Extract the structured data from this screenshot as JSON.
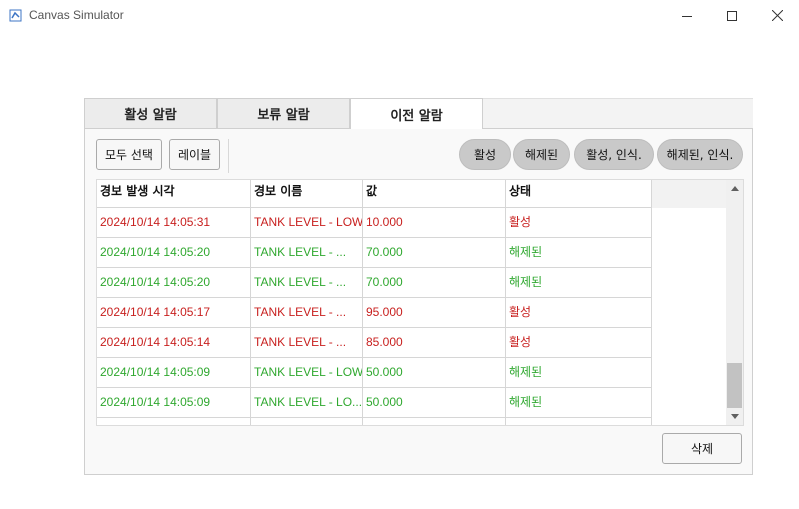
{
  "window": {
    "title": "Canvas Simulator"
  },
  "tabs": [
    {
      "label": "활성 알람",
      "active": false
    },
    {
      "label": "보류 알람",
      "active": false
    },
    {
      "label": "이전 알람",
      "active": true
    }
  ],
  "toolbar": {
    "select_all": "모두 선택",
    "label_btn": "레이블"
  },
  "filters": [
    "활성",
    "해제된",
    "활성, 인식.",
    "해제된, 인식."
  ],
  "table": {
    "columns": [
      "경보 발생 시각",
      "경보 이름",
      "값",
      "상태"
    ],
    "rows": [
      {
        "time": "2024/10/14 14:05:31",
        "name": "TANK LEVEL - LOW",
        "value": "10.000",
        "state": "활성",
        "kind": "active"
      },
      {
        "time": "2024/10/14 14:05:20",
        "name": "TANK LEVEL - ...",
        "value": "70.000",
        "state": "해제된",
        "kind": "cleared"
      },
      {
        "time": "2024/10/14 14:05:20",
        "name": "TANK LEVEL - ...",
        "value": "70.000",
        "state": "해제된",
        "kind": "cleared"
      },
      {
        "time": "2024/10/14 14:05:17",
        "name": "TANK LEVEL - ...",
        "value": "95.000",
        "state": "활성",
        "kind": "active"
      },
      {
        "time": "2024/10/14 14:05:14",
        "name": "TANK LEVEL - ...",
        "value": "85.000",
        "state": "활성",
        "kind": "active"
      },
      {
        "time": "2024/10/14 14:05:09",
        "name": "TANK LEVEL - LOW",
        "value": "50.000",
        "state": "해제된",
        "kind": "cleared"
      },
      {
        "time": "2024/10/14 14:05:09",
        "name": "TANK LEVEL - LO...",
        "value": "50.000",
        "state": "해제된",
        "kind": "cleared"
      },
      {
        "time": "",
        "name": "",
        "value": "",
        "state": "",
        "kind": "cleared"
      }
    ]
  },
  "footer": {
    "delete": "삭제"
  },
  "colors": {
    "active": "#c8201f",
    "cleared": "#2fa82f"
  }
}
